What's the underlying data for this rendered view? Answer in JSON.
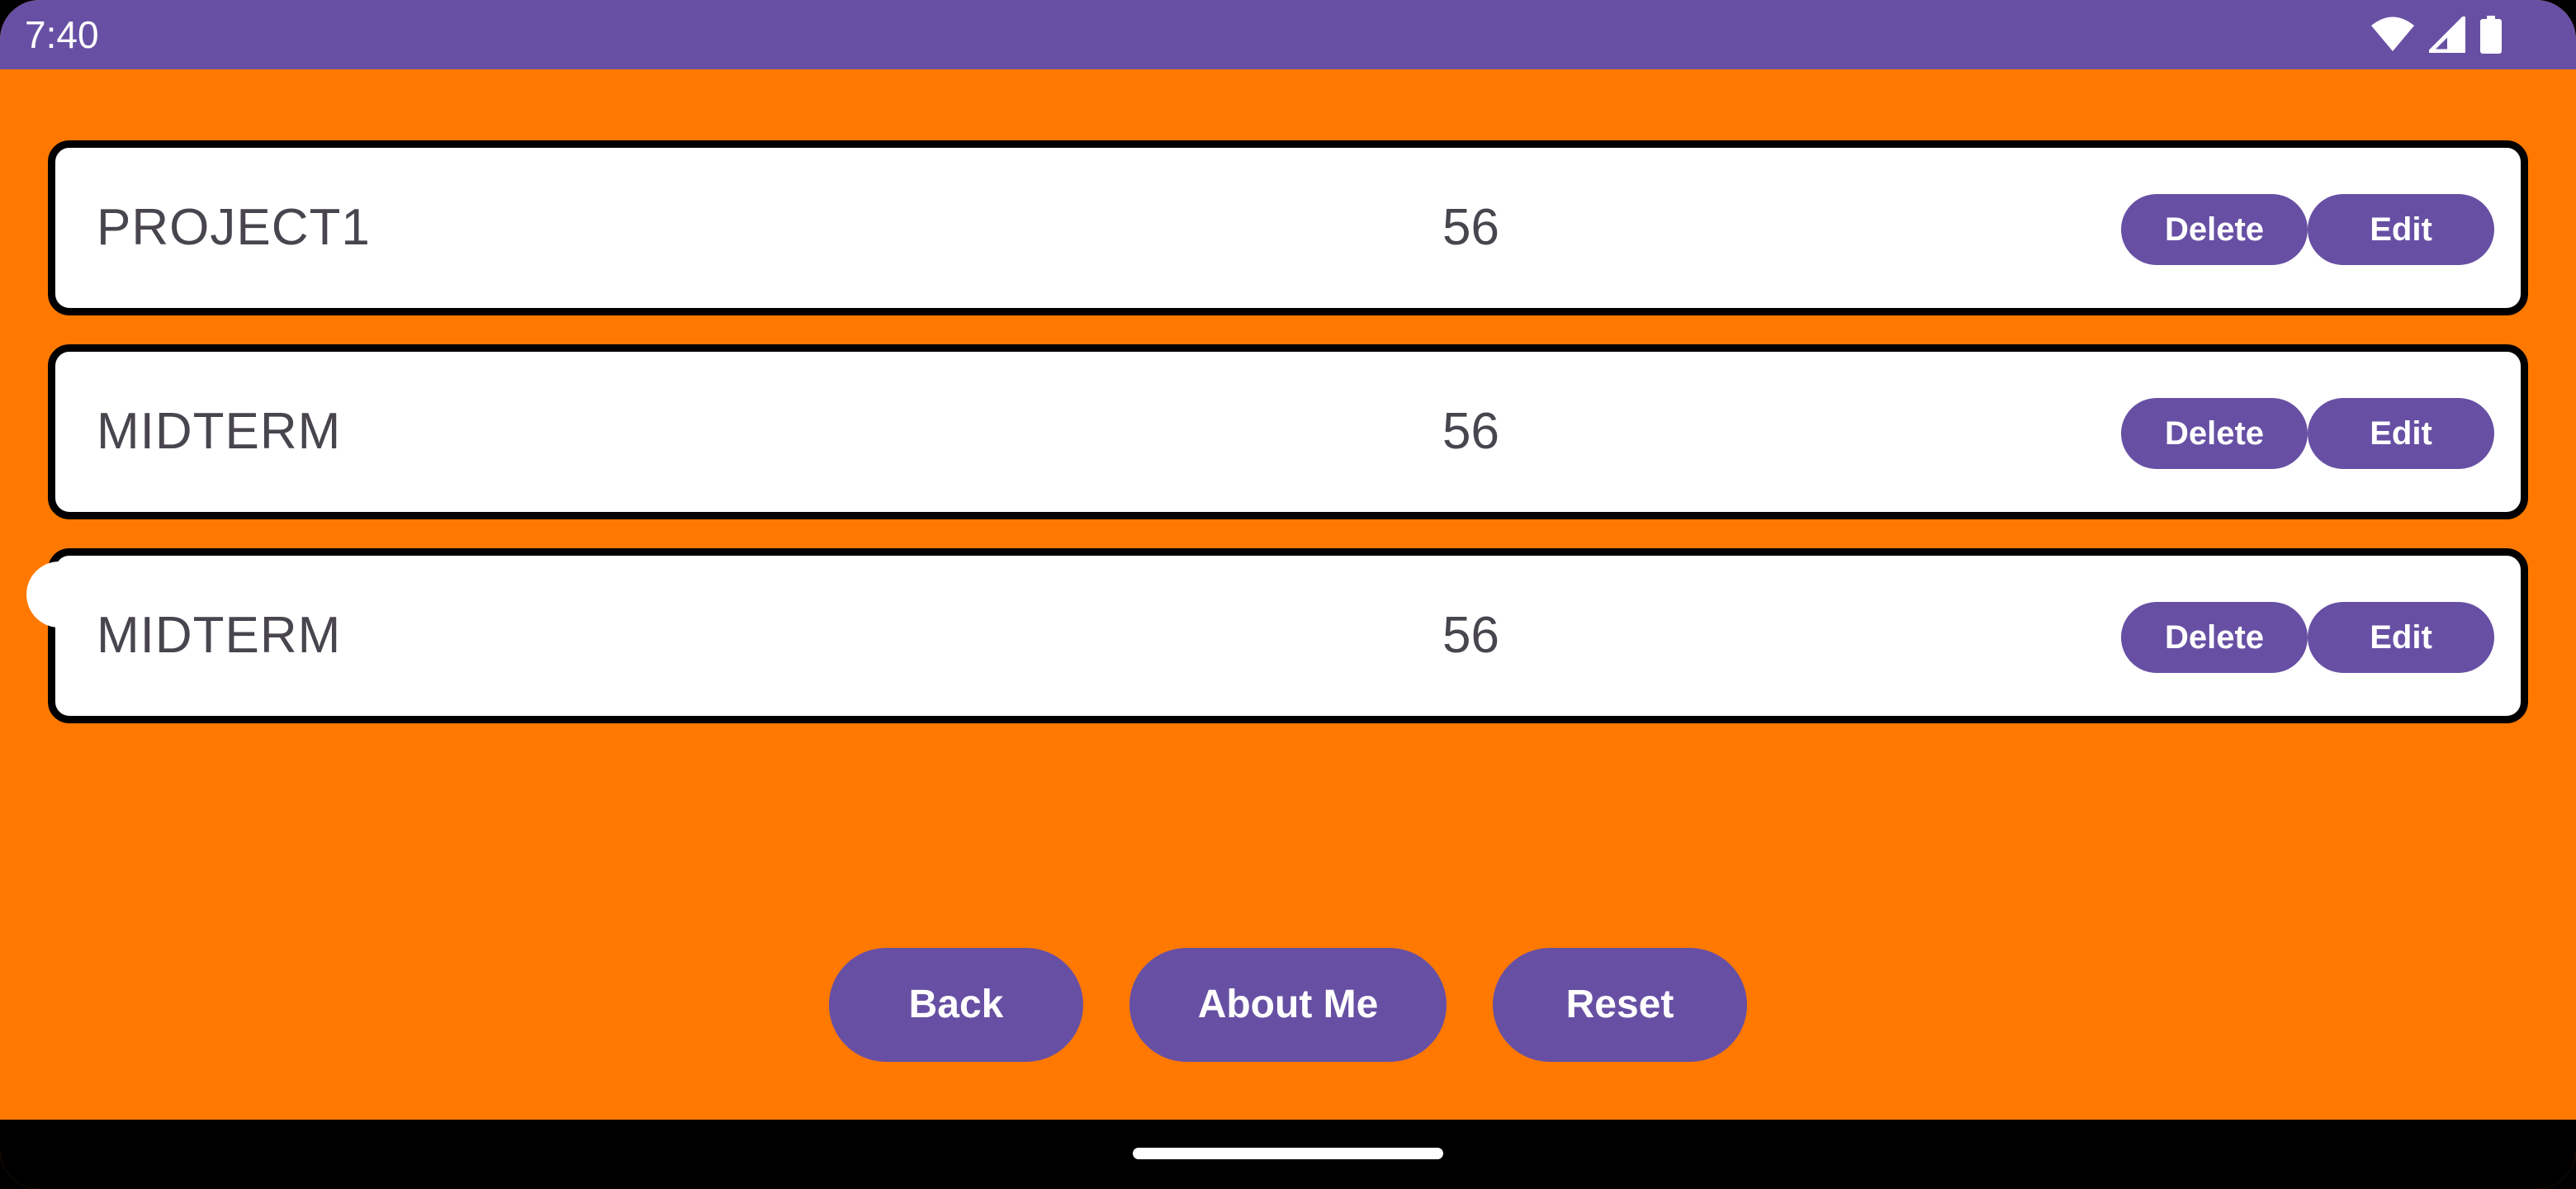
{
  "status_bar": {
    "time": "7:40",
    "icons": [
      "wifi-icon",
      "cell-signal-icon",
      "battery-icon"
    ],
    "background": "#6750A4"
  },
  "app": {
    "background": "#FF7900",
    "accent": "#6750A4"
  },
  "list": {
    "items": [
      {
        "name": "PROJECT1",
        "score": "56",
        "delete_label": "Delete",
        "edit_label": "Edit"
      },
      {
        "name": "MIDTERM",
        "score": "56",
        "delete_label": "Delete",
        "edit_label": "Edit"
      },
      {
        "name": "MIDTERM",
        "score": "56",
        "delete_label": "Delete",
        "edit_label": "Edit"
      }
    ]
  },
  "actions": {
    "back_label": "Back",
    "about_label": "About Me",
    "reset_label": "Reset"
  }
}
